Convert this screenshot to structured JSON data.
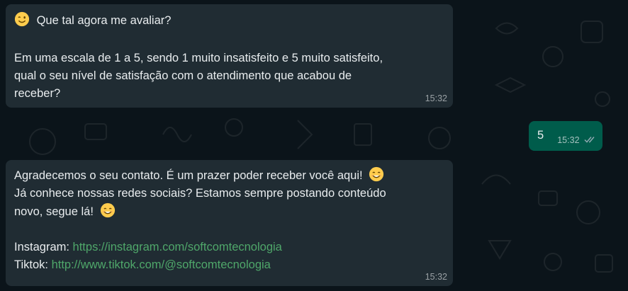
{
  "chat": {
    "messages": [
      {
        "direction": "incoming",
        "line1_text": "Que tal agora me avaliar?",
        "line1_emoji": "winking-face-emoji",
        "body": "Em uma escala de 1 a 5, sendo 1 muito insatisfeito e 5 muito satisfeito,\nqual o seu nível de satisfação com o atendimento que acabou de\nreceber?",
        "time": "15:32"
      },
      {
        "direction": "outgoing",
        "text": "5",
        "time": "15:32",
        "status_icon": "double-check-read-icon"
      },
      {
        "direction": "incoming",
        "line1": "Agradecemos o seu contato. É um prazer poder receber você aqui!",
        "line2": "Já conhece nossas redes sociais? Estamos sempre postando conteúdo",
        "line3": "novo, segue lá!",
        "emoji": "smiling-face-emoji",
        "instagram_label": "Instagram:",
        "instagram_url": "https://instagram.com/softcomtecnologia",
        "tiktok_label": "Tiktok:",
        "tiktok_url": "http://www.tiktok.com/@softcomtecnologia",
        "time": "15:32"
      }
    ],
    "colors": {
      "background": "#0b141a",
      "incoming_bubble": "#202c33",
      "outgoing_bubble": "#005c4b",
      "text": "#e9edef",
      "link": "#4fa76a"
    }
  }
}
